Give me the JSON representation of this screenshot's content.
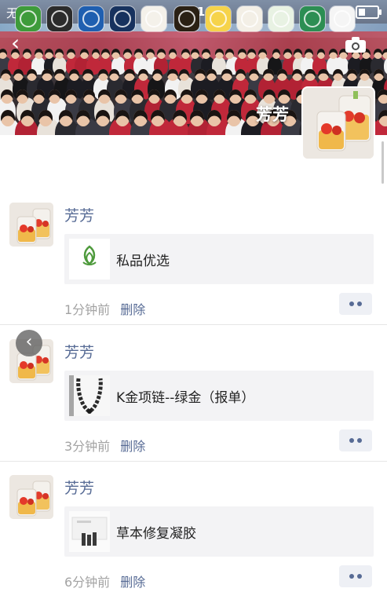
{
  "status_bar": {
    "carrier": "无",
    "time": "10:1"
  },
  "app_shortcuts": [
    {
      "icon": "green-leaf-logo-icon",
      "color": "#3e9b3a"
    },
    {
      "icon": "black-square-logo-icon",
      "color": "#2b2b2b"
    },
    {
      "icon": "blue-swirl-logo-icon",
      "color": "#1f5fb0"
    },
    {
      "icon": "dark-blue-circle-logo-icon",
      "color": "#17325e"
    },
    {
      "icon": "white-round-badge-logo-icon",
      "color": "#f4f1ea"
    },
    {
      "icon": "gold-round-badge-logo-icon",
      "color": "#2a2014"
    },
    {
      "icon": "sun-landscape-logo-icon",
      "color": "#f6d34a"
    },
    {
      "icon": "red-ring-seal-logo-icon",
      "color": "#f3efe6"
    },
    {
      "icon": "green-plant-logo-icon",
      "color": "#e8f2e3"
    },
    {
      "icon": "bx-green-logo-icon",
      "color": "#2c8e53"
    },
    {
      "icon": "red-heart-logo-icon",
      "color": "#f5f5f5"
    }
  ],
  "profile": {
    "name": "芳芳"
  },
  "posts": [
    {
      "author": "芳芳",
      "link_title": "私品优选",
      "thumb_icon": "leaf-brand-logo-icon",
      "thumb_caption": "私品优选",
      "time": "1分钟前",
      "delete_label": "删除"
    },
    {
      "author": "芳芳",
      "link_title": "K金项链--绿金（报单）",
      "thumb_icon": "necklace-icon",
      "time": "3分钟前",
      "delete_label": "删除"
    },
    {
      "author": "芳芳",
      "link_title": "草本修复凝胶",
      "thumb_icon": "product-bottles-icon",
      "time": "6分钟前",
      "delete_label": "删除"
    }
  ],
  "colors": {
    "link_blue": "#576b95",
    "meta_gray": "#a3a3a3",
    "card_bg": "#f3f3f5"
  }
}
